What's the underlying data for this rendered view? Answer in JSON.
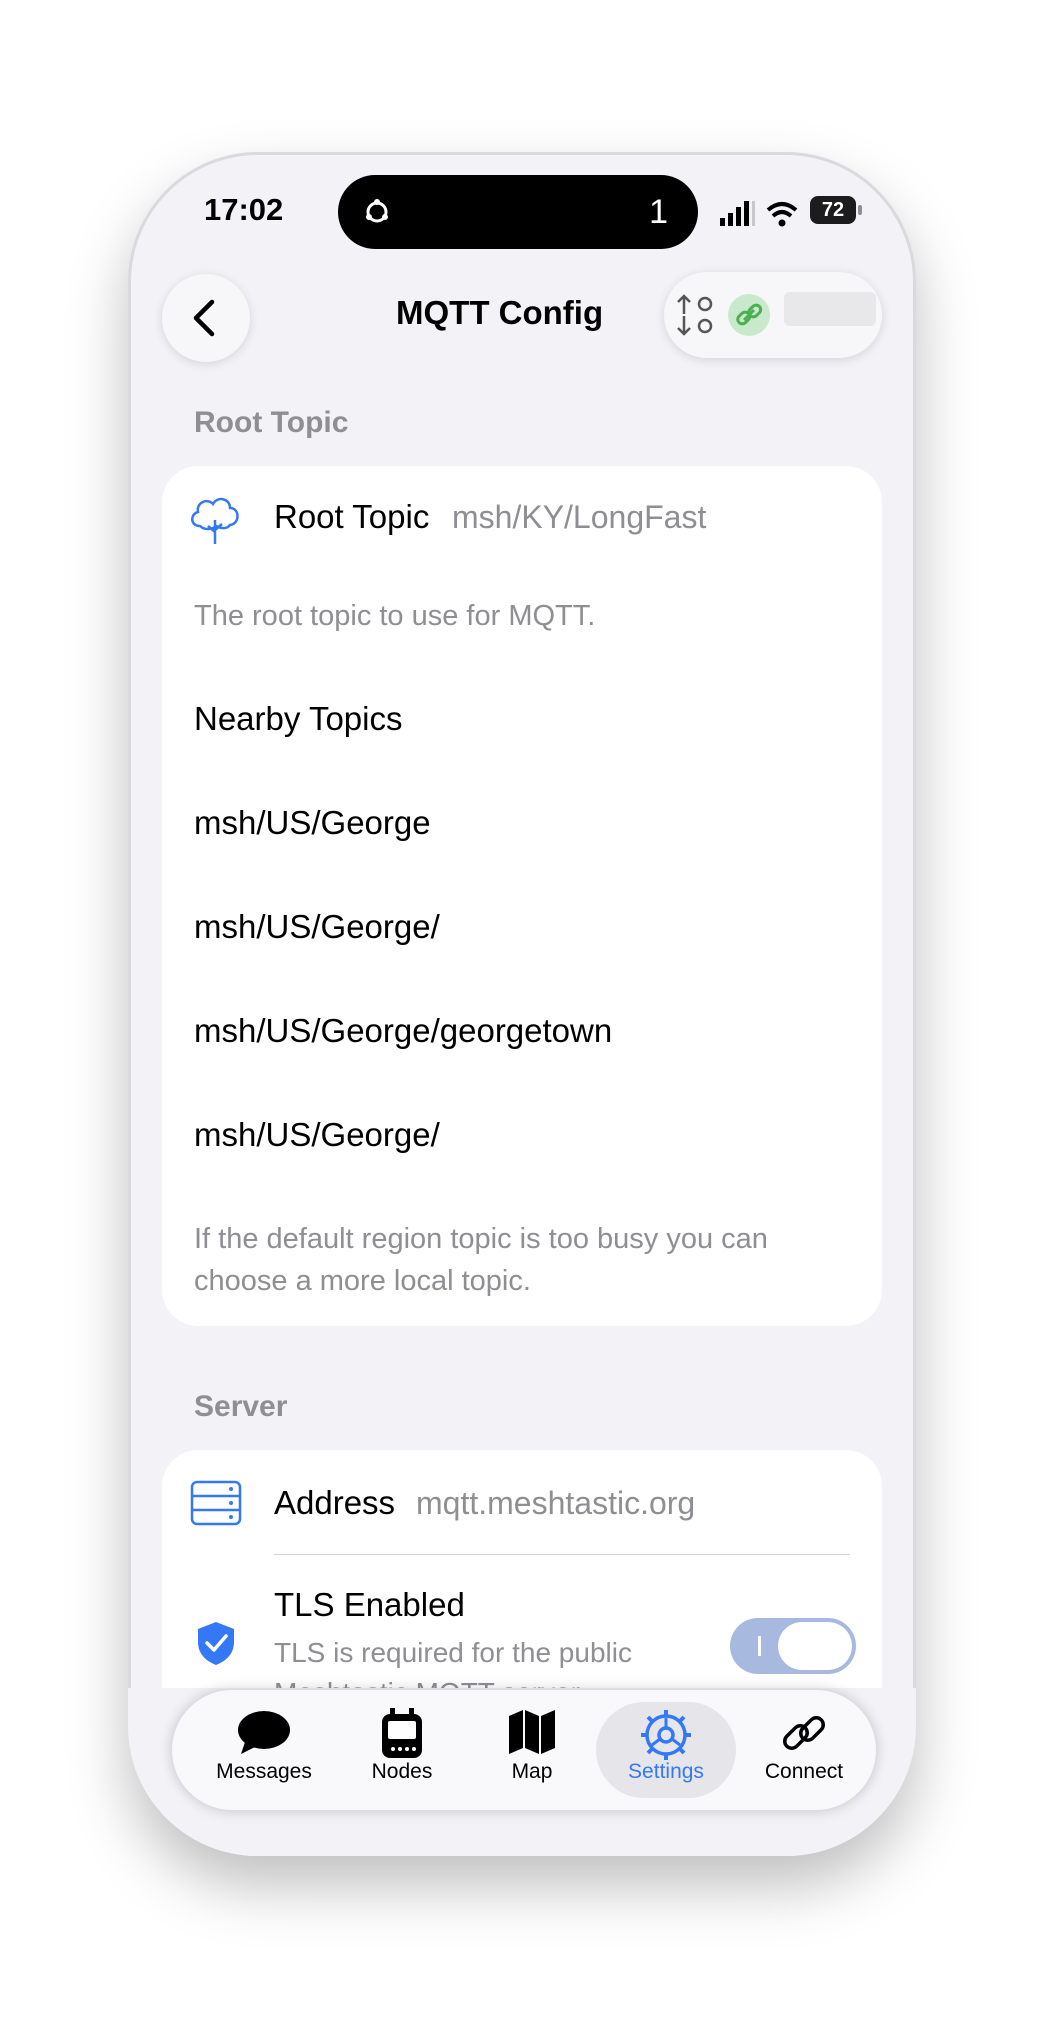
{
  "status_bar": {
    "time": "17:02",
    "island_count": "1",
    "battery": "72"
  },
  "nav": {
    "title": "MQTT Config"
  },
  "root_topic_section": {
    "header": "Root Topic",
    "root_topic_label": "Root Topic",
    "root_topic_value": "msh/KY/LongFast",
    "root_topic_note": "The root topic to use for MQTT.",
    "nearby_label": "Nearby Topics",
    "topics": [
      "msh/US/George",
      "msh/US/George/",
      "msh/US/George/georgetown",
      "msh/US/George/"
    ],
    "nearby_note_line1": "If the default region topic is too busy you can",
    "nearby_note_line2": "choose a more local topic."
  },
  "server_section": {
    "header": "Server",
    "address_label": "Address",
    "address_value": "mqtt.meshtastic.org",
    "tls_label": "TLS Enabled",
    "tls_note_line1": "TLS is required for the public",
    "tls_note_line2": "Meshtastic MQTT server",
    "tls_enabled": true
  },
  "tabbar": {
    "tabs": [
      {
        "label": "Messages",
        "icon": "message-bubble-icon"
      },
      {
        "label": "Nodes",
        "icon": "device-icon"
      },
      {
        "label": "Map",
        "icon": "map-icon"
      },
      {
        "label": "Settings",
        "icon": "gear-icon"
      },
      {
        "label": "Connect",
        "icon": "link-icon"
      }
    ],
    "active": "Settings"
  },
  "colors": {
    "accent": "#3478f6",
    "secondary_text": "#8e8e93",
    "toggle_on": "#a7b9de"
  }
}
